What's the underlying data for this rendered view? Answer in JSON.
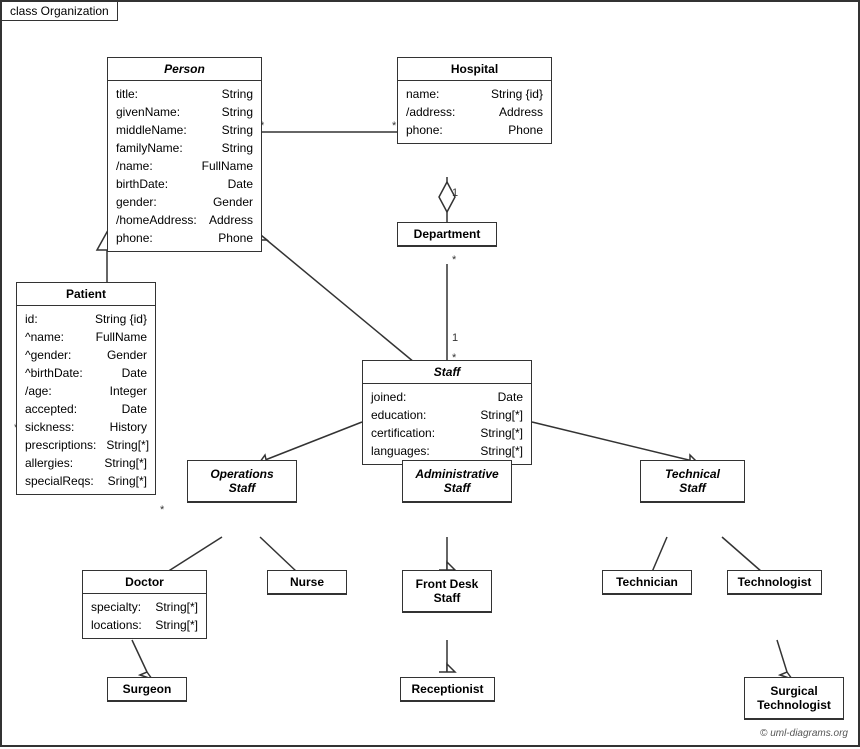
{
  "diagram": {
    "title": "class Organization",
    "copyright": "© uml-diagrams.org",
    "boxes": {
      "person": {
        "title": "Person",
        "italic": true,
        "attrs": [
          [
            "title:",
            "String"
          ],
          [
            "givenName:",
            "String"
          ],
          [
            "middleName:",
            "String"
          ],
          [
            "familyName:",
            "String"
          ],
          [
            "/name:",
            "FullName"
          ],
          [
            "birthDate:",
            "Date"
          ],
          [
            "gender:",
            "Gender"
          ],
          [
            "/homeAddress:",
            "Address"
          ],
          [
            "phone:",
            "Phone"
          ]
        ]
      },
      "hospital": {
        "title": "Hospital",
        "attrs": [
          [
            "name:",
            "String {id}"
          ],
          [
            "/address:",
            "Address"
          ],
          [
            "phone:",
            "Phone"
          ]
        ]
      },
      "patient": {
        "title": "Patient",
        "attrs": [
          [
            "id:",
            "String {id}"
          ],
          [
            "^name:",
            "FullName"
          ],
          [
            "^gender:",
            "Gender"
          ],
          [
            "^birthDate:",
            "Date"
          ],
          [
            "/age:",
            "Integer"
          ],
          [
            "accepted:",
            "Date"
          ],
          [
            "sickness:",
            "History"
          ],
          [
            "prescriptions:",
            "String[*]"
          ],
          [
            "allergies:",
            "String[*]"
          ],
          [
            "specialReqs:",
            "Sring[*]"
          ]
        ]
      },
      "department": {
        "title": "Department",
        "attrs": []
      },
      "staff": {
        "title": "Staff",
        "italic": true,
        "attrs": [
          [
            "joined:",
            "Date"
          ],
          [
            "education:",
            "String[*]"
          ],
          [
            "certification:",
            "String[*]"
          ],
          [
            "languages:",
            "String[*]"
          ]
        ]
      },
      "operations_staff": {
        "title": "Operations Staff",
        "italic": true,
        "attrs": []
      },
      "administrative_staff": {
        "title": "Administrative Staff",
        "italic": true,
        "attrs": []
      },
      "technical_staff": {
        "title": "Technical Staff",
        "italic": true,
        "attrs": []
      },
      "doctor": {
        "title": "Doctor",
        "attrs": [
          [
            "specialty:",
            "String[*]"
          ],
          [
            "locations:",
            "String[*]"
          ]
        ]
      },
      "nurse": {
        "title": "Nurse",
        "attrs": []
      },
      "front_desk_staff": {
        "title": "Front Desk Staff",
        "attrs": []
      },
      "technician": {
        "title": "Technician",
        "attrs": []
      },
      "technologist": {
        "title": "Technologist",
        "attrs": []
      },
      "surgeon": {
        "title": "Surgeon",
        "attrs": []
      },
      "receptionist": {
        "title": "Receptionist",
        "attrs": []
      },
      "surgical_technologist": {
        "title": "Surgical Technologist",
        "attrs": []
      }
    }
  }
}
